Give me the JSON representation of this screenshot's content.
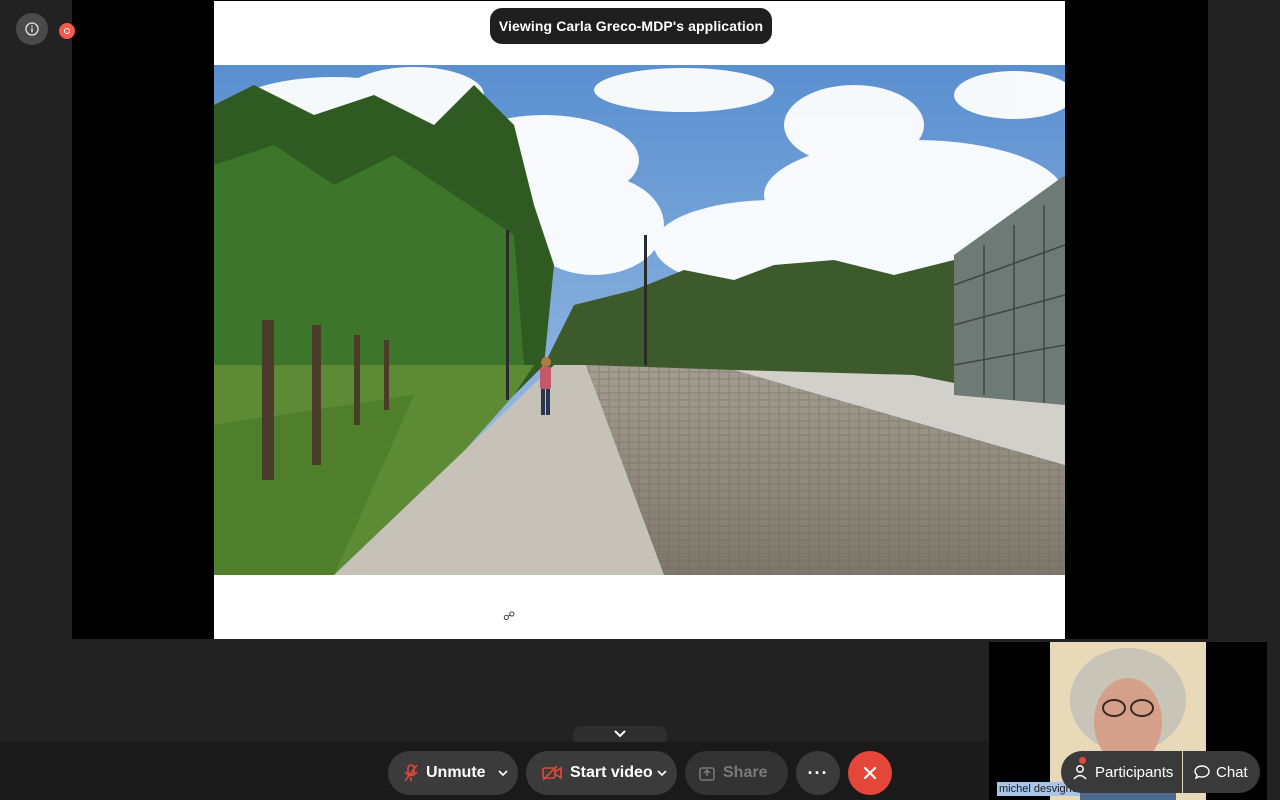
{
  "banner": {
    "text": "Viewing Carla Greco-MDP's application"
  },
  "toolbar": {
    "unmute_label": "Unmute",
    "start_video_label": "Start video",
    "share_label": "Share",
    "more_label": "···"
  },
  "panel": {
    "participants_label": "Participants",
    "chat_label": "Chat"
  },
  "self_view": {
    "name": "michel desvigne"
  },
  "colors": {
    "end_call": "#e5463a",
    "recording": "#f25b4d",
    "accent_icon": "#e5463a"
  },
  "icons": [
    "info-icon",
    "recording-icon",
    "microphone-muted-icon",
    "video-off-icon",
    "share-icon",
    "more-icon",
    "close-icon",
    "participants-icon",
    "chat-icon",
    "chevron-down-icon"
  ]
}
